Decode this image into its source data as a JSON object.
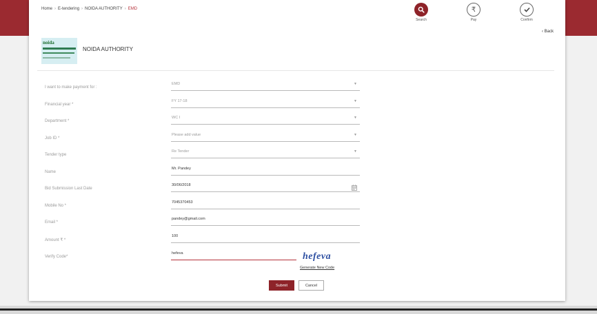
{
  "breadcrumb": [
    "Home",
    "E-tendering",
    "NOIDA AUTHORITY",
    "EMD"
  ],
  "steps": [
    {
      "label": "Search",
      "icon": "search-icon",
      "active": true
    },
    {
      "label": "Pay",
      "icon": "rupee-icon",
      "active": false
    },
    {
      "label": "Confirm",
      "icon": "check-icon",
      "active": false
    }
  ],
  "back_label": "Back",
  "org_name": "NOIDA AUTHORITY",
  "logo_text": "noida",
  "form": {
    "payment_for": {
      "label": "I want to make payment for :",
      "value": "EMD"
    },
    "financial_year": {
      "label": "Financial year *",
      "value": "FY 17-18"
    },
    "department": {
      "label": "Department *",
      "value": "WC I"
    },
    "job_id": {
      "label": "Job ID *",
      "placeholder": "Please add value"
    },
    "tender_type": {
      "label": "Tender type",
      "value": "Re Tender"
    },
    "name": {
      "label": "Name",
      "value": "Mr. Pandey"
    },
    "bid_submission_last_date": {
      "label": "Bid Submission Last Date",
      "value": "30/06/2018"
    },
    "mobile_no": {
      "label": "Mobile No *",
      "value": "7045370453"
    },
    "email": {
      "label": "Email *",
      "value": "pandey@gmail.com"
    },
    "amount": {
      "label": "Amount ₹ *",
      "value": "100"
    },
    "verify_code": {
      "label": "Verify Code*",
      "value": "hefeva"
    }
  },
  "captcha_text": "hefeva",
  "generate_new_code": "Generate New Code",
  "buttons": {
    "submit": "Submit",
    "cancel": "Cancel"
  },
  "colors": {
    "brand": "#8e2329",
    "band": "#9b2a30",
    "captcha": "#2d4fa1"
  }
}
